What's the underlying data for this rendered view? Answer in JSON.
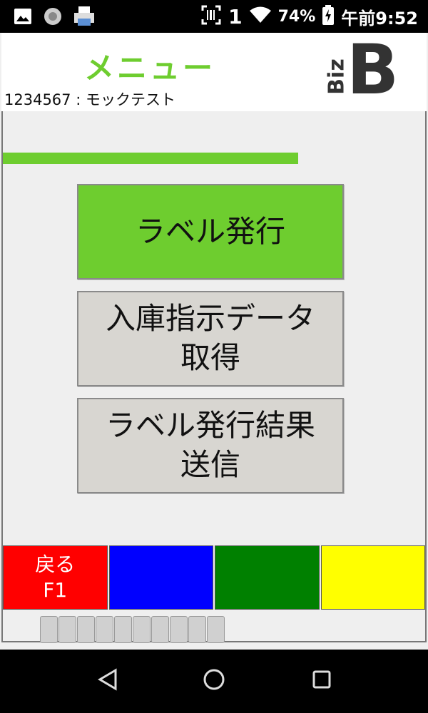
{
  "status_bar": {
    "notifications": [
      "image-icon",
      "settings-circle-icon",
      "printer-icon"
    ],
    "sim_number": "1",
    "battery_percent": "74%",
    "time": "午前9:52"
  },
  "header": {
    "title": "メニュー",
    "user_info": "1234567 : モックテスト",
    "logo_small": "Biz",
    "logo_big": "B"
  },
  "menu": {
    "label_issue": "ラベル発行",
    "receive_line1": "入庫指示データ",
    "receive_line2": "取得",
    "send_line1": "ラベル発行結果",
    "send_line2": "送信"
  },
  "function_keys": {
    "f1_line1": "戻る",
    "f1_line2": "F1",
    "colors": [
      "#ff0000",
      "#0000ff",
      "#008000",
      "#ffff00"
    ]
  },
  "indicator": {
    "cells": 10
  },
  "accent_color": "#6ecd2f"
}
